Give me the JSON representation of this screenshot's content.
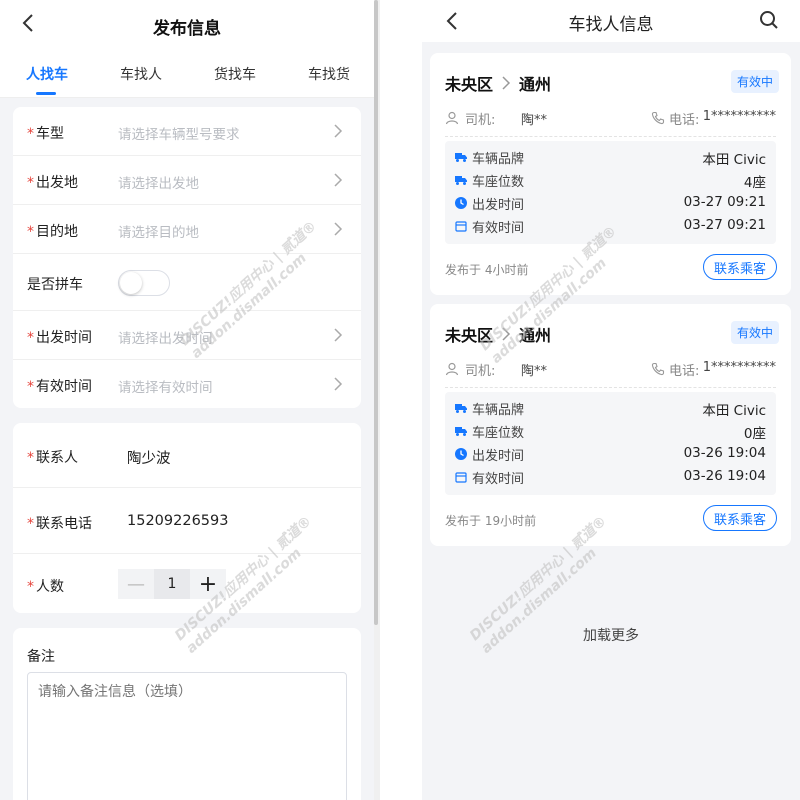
{
  "left": {
    "title": "发布信息",
    "tabs": [
      "人找车",
      "车找人",
      "货找车",
      "车找货"
    ],
    "active_tab": 0,
    "form_rows": [
      {
        "label": "车型",
        "required": true,
        "placeholder": "请选择车辆型号要求"
      },
      {
        "label": "出发地",
        "required": true,
        "placeholder": "请选择出发地"
      },
      {
        "label": "目的地",
        "required": true,
        "placeholder": "请选择目的地"
      },
      {
        "label": "是否拼车",
        "required": false,
        "toggle": false
      },
      {
        "label": "出发时间",
        "required": true,
        "placeholder": "请选择出发时间"
      },
      {
        "label": "有效时间",
        "required": true,
        "placeholder": "请选择有效时间"
      }
    ],
    "contact_rows": [
      {
        "label": "联系人",
        "required": true,
        "value": "陶少波"
      },
      {
        "label": "联系电话",
        "required": true,
        "value": "15209226593"
      }
    ],
    "people": {
      "label": "人数",
      "required": true,
      "value": "1",
      "minus": "—",
      "plus": "+"
    },
    "notes": {
      "title": "备注",
      "placeholder": "请输入备注信息（选填）"
    }
  },
  "right": {
    "title": "车找人信息",
    "trips": [
      {
        "from": "未央区",
        "to": "通州",
        "status": "有效中",
        "driver_label": "司机:",
        "driver": "陶**",
        "phone_label": "电话:",
        "phone": "1**********",
        "rows": [
          {
            "label": "车辆品牌",
            "value": "本田 Civic",
            "icon": "truck-icon"
          },
          {
            "label": "车座位数",
            "value": "4座",
            "icon": "truck-icon"
          },
          {
            "label": "出发时间",
            "value": "03-27 09:21",
            "icon": "clock-icon"
          },
          {
            "label": "有效时间",
            "value": "03-27 09:21",
            "icon": "calendar-icon"
          }
        ],
        "posted": "发布于 4小时前",
        "button": "联系乘客"
      },
      {
        "from": "未央区",
        "to": "通州",
        "status": "有效中",
        "driver_label": "司机:",
        "driver": "陶**",
        "phone_label": "电话:",
        "phone": "1**********",
        "rows": [
          {
            "label": "车辆品牌",
            "value": "本田 Civic",
            "icon": "truck-icon"
          },
          {
            "label": "车座位数",
            "value": "0座",
            "icon": "truck-icon"
          },
          {
            "label": "出发时间",
            "value": "03-26 19:04",
            "icon": "clock-icon"
          },
          {
            "label": "有效时间",
            "value": "03-26 19:04",
            "icon": "calendar-icon"
          }
        ],
        "posted": "发布于 19小时前",
        "button": "联系乘客"
      }
    ],
    "load_more": "加载更多"
  },
  "watermark": {
    "line1": "DISCUZ!应用中心 | 贰道®",
    "line2": "addon.dismall.com"
  },
  "colors": {
    "accent": "#1677ff",
    "required": "#e5443b",
    "page_bg": "#f3f4f7"
  }
}
